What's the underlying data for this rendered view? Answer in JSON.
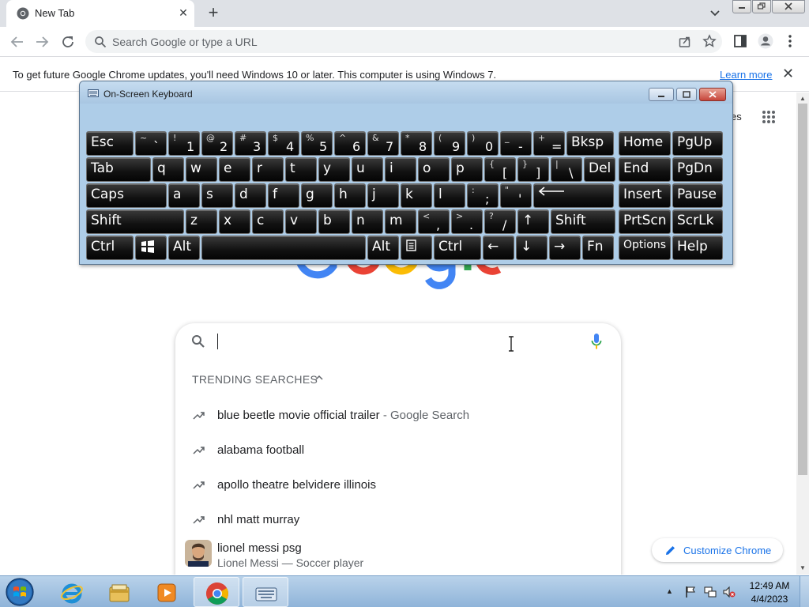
{
  "browser": {
    "tab": {
      "title": "New Tab",
      "favicon": "chrome-icon"
    },
    "omnibox": {
      "placeholder": "Search Google or type a URL"
    }
  },
  "infobar": {
    "message": "To get future Google Chrome updates, you'll need Windows 10 or later. This computer is using Windows 7.",
    "link": "Learn more"
  },
  "page": {
    "images_fragment": "es",
    "trending": {
      "heading": "TRENDING SEARCHES",
      "items": [
        {
          "text": "blue beetle movie official trailer",
          "suffix": " - Google Search"
        },
        {
          "text": "alabama football"
        },
        {
          "text": "apollo theatre belvidere illinois"
        },
        {
          "text": "nhl matt murray"
        },
        {
          "text": "lionel messi psg",
          "subtitle": "Lionel Messi — Soccer player"
        }
      ]
    },
    "customize_label": "Customize Chrome"
  },
  "osk": {
    "title": "On-Screen Keyboard",
    "rows": [
      [
        {
          "label": "Esc"
        },
        {
          "hi": "~",
          "lo": "`"
        },
        {
          "hi": "!",
          "lo": "1"
        },
        {
          "hi": "@",
          "lo": "2"
        },
        {
          "hi": "#",
          "lo": "3"
        },
        {
          "hi": "$",
          "lo": "4"
        },
        {
          "hi": "%",
          "lo": "5"
        },
        {
          "hi": "^",
          "lo": "6"
        },
        {
          "hi": "&",
          "lo": "7"
        },
        {
          "hi": "*",
          "lo": "8"
        },
        {
          "hi": "(",
          "lo": "9"
        },
        {
          "hi": ")",
          "lo": "0"
        },
        {
          "hi": "_",
          "lo": "-"
        },
        {
          "hi": "+",
          "lo": "="
        },
        {
          "label": "Bksp"
        },
        {
          "label": "Home"
        },
        {
          "label": "PgUp"
        }
      ],
      [
        {
          "label": "Tab"
        },
        {
          "label": "q"
        },
        {
          "label": "w"
        },
        {
          "label": "e"
        },
        {
          "label": "r"
        },
        {
          "label": "t"
        },
        {
          "label": "y"
        },
        {
          "label": "u"
        },
        {
          "label": "i"
        },
        {
          "label": "o"
        },
        {
          "label": "p"
        },
        {
          "hi": "{",
          "lo": "["
        },
        {
          "hi": "}",
          "lo": "]"
        },
        {
          "hi": "|",
          "lo": "\\"
        },
        {
          "label": "Del"
        },
        {
          "label": "End"
        },
        {
          "label": "PgDn"
        }
      ],
      [
        {
          "label": "Caps"
        },
        {
          "label": "a"
        },
        {
          "label": "s"
        },
        {
          "label": "d"
        },
        {
          "label": "f"
        },
        {
          "label": "g"
        },
        {
          "label": "h"
        },
        {
          "label": "j"
        },
        {
          "label": "k"
        },
        {
          "label": "l"
        },
        {
          "hi": ":",
          "lo": ";"
        },
        {
          "hi": "\"",
          "lo": "'"
        },
        {
          "icon": "enter-arrow"
        },
        {
          "label": "Insert"
        },
        {
          "label": "Pause"
        }
      ],
      [
        {
          "label": "Shift"
        },
        {
          "label": "z"
        },
        {
          "label": "x"
        },
        {
          "label": "c"
        },
        {
          "label": "v"
        },
        {
          "label": "b"
        },
        {
          "label": "n"
        },
        {
          "label": "m"
        },
        {
          "hi": "<",
          "lo": ","
        },
        {
          "hi": ">",
          "lo": "."
        },
        {
          "hi": "?",
          "lo": "/"
        },
        {
          "label": "↑"
        },
        {
          "label": "Shift"
        },
        {
          "label": "PrtScn"
        },
        {
          "label": "ScrLk"
        }
      ],
      [
        {
          "label": "Ctrl"
        },
        {
          "icon": "windows-logo"
        },
        {
          "label": "Alt"
        },
        {
          "label": ""
        },
        {
          "label": "Alt"
        },
        {
          "icon": "menu-key"
        },
        {
          "label": "Ctrl"
        },
        {
          "label": "←"
        },
        {
          "label": "↓"
        },
        {
          "label": "→"
        },
        {
          "label": "Fn"
        },
        {
          "label": "Options"
        },
        {
          "label": "Help"
        }
      ]
    ]
  },
  "taskbar": {
    "apps": [
      "explorer-icon",
      "internet-explorer-icon",
      "file-manager-icon",
      "media-player-icon",
      "chrome-icon",
      "on-screen-keyboard-icon"
    ],
    "time": "12:49 AM",
    "date": "4/4/2023"
  },
  "colors": {
    "accent": "#1a73e8",
    "infobar_link": "#1a73e8",
    "taskbar": "#a6c4e2"
  }
}
